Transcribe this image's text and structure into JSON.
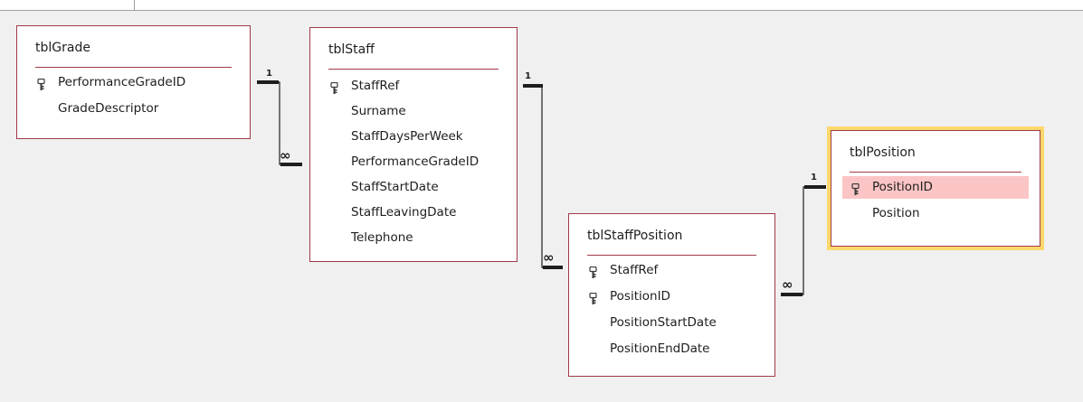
{
  "tables": [
    {
      "name": "tblGrade",
      "fields": [
        {
          "label": "PerformanceGradeID",
          "pk": true
        },
        {
          "label": "GradeDescriptor",
          "pk": false
        }
      ]
    },
    {
      "name": "tblStaff",
      "fields": [
        {
          "label": "StaffRef",
          "pk": true
        },
        {
          "label": "Surname",
          "pk": false
        },
        {
          "label": "StaffDaysPerWeek",
          "pk": false
        },
        {
          "label": "PerformanceGradeID",
          "pk": false
        },
        {
          "label": "StaffStartDate",
          "pk": false
        },
        {
          "label": "StaffLeavingDate",
          "pk": false
        },
        {
          "label": "Telephone",
          "pk": false
        }
      ]
    },
    {
      "name": "tblStaffPosition",
      "fields": [
        {
          "label": "StaffRef",
          "pk": true
        },
        {
          "label": "PositionID",
          "pk": true
        },
        {
          "label": "PositionStartDate",
          "pk": false
        },
        {
          "label": "PositionEndDate",
          "pk": false
        }
      ]
    },
    {
      "name": "tblPosition",
      "selected": true,
      "fields": [
        {
          "label": "PositionID",
          "pk": true,
          "selected": true
        },
        {
          "label": "Position",
          "pk": false
        }
      ]
    }
  ],
  "relationships": [
    {
      "from": "tblGrade.PerformanceGradeID",
      "to": "tblStaff.PerformanceGradeID",
      "one_label": "1",
      "many_label": "∞"
    },
    {
      "from": "tblStaff.StaffRef",
      "to": "tblStaffPosition.StaffRef",
      "one_label": "1",
      "many_label": "∞"
    },
    {
      "from": "tblPosition.PositionID",
      "to": "tblStaffPosition.PositionID",
      "one_label": "1",
      "many_label": "∞"
    }
  ],
  "colors": {
    "canvas": "#f0f0f0",
    "table_border": "#a03a48",
    "selected_outline": "#fbd86a",
    "selected_field": "#fcc5c5",
    "line": "#1e1e1e"
  }
}
